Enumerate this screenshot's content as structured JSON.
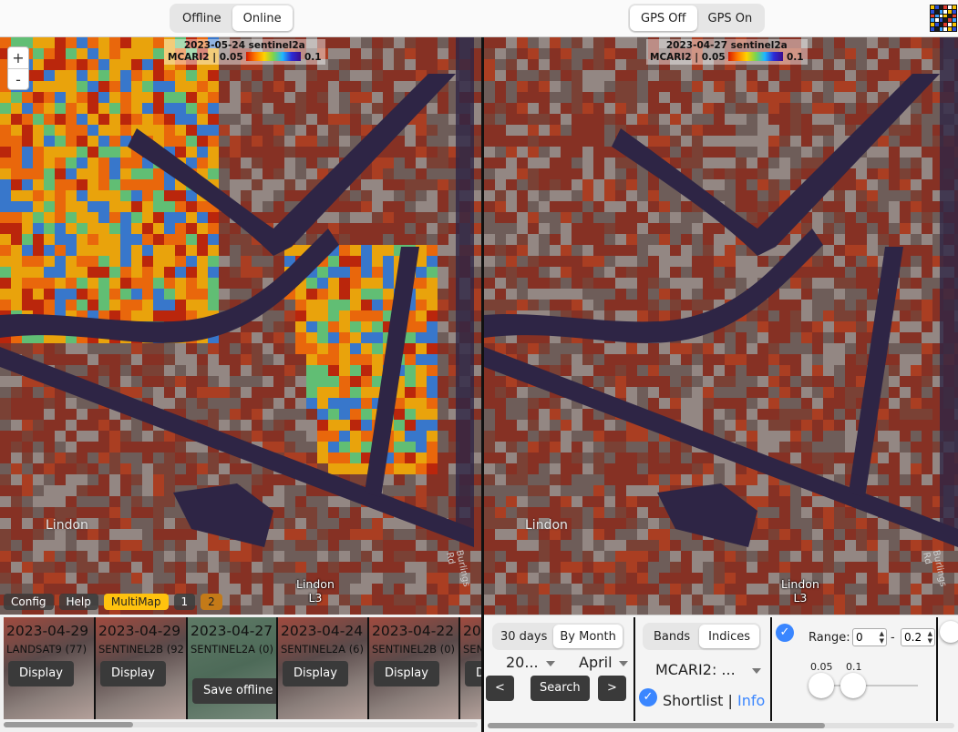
{
  "top_bar": {
    "connection_modes": [
      "Offline",
      "Online"
    ],
    "connection_active": "Online",
    "gps_modes": [
      "GPS Off",
      "GPS On"
    ],
    "gps_active": "GPS Off",
    "logo_icon": "grid-logo-icon"
  },
  "maps": [
    {
      "date_sensor": "2023-05-24 sentinel2a",
      "index": "MCARI2",
      "scale_min": "0.05",
      "scale_max": "0.1",
      "place_label": "Lindon",
      "poi_line1": "Lindon",
      "poi_line2": "L3",
      "road_label": "Burlings Rd"
    },
    {
      "date_sensor": "2023-04-27 sentinel2a",
      "index": "MCARI2",
      "scale_min": "0.05",
      "scale_max": "0.1",
      "place_label": "Lindon",
      "poi_line1": "Lindon",
      "poi_line2": "L3",
      "road_label": "Burlings Rd"
    }
  ],
  "zoom": {
    "in": "+",
    "out": "-"
  },
  "map_buttons": {
    "config": "Config",
    "help": "Help",
    "multimap": "MultiMap",
    "map1": "1",
    "map2": "2"
  },
  "image_strip": [
    {
      "date": "2023-04-29",
      "sensor": "LANDSAT9 (77)",
      "action": "Display"
    },
    {
      "date": "2023-04-29",
      "sensor": "SENTINEL2B (92",
      "action": "Display"
    },
    {
      "date": "2023-04-27",
      "sensor": "SENTINEL2A (0)",
      "action": "Save offline"
    },
    {
      "date": "2023-04-24",
      "sensor": "SENTINEL2A (6)",
      "action": "Display"
    },
    {
      "date": "2023-04-22",
      "sensor": "SENTINEL2B (0)",
      "action": "Display"
    },
    {
      "date": "20",
      "sensor": "SEN",
      "action": "D"
    }
  ],
  "date_panel": {
    "modes": [
      "30 days",
      "By Month"
    ],
    "active_mode": "By Month",
    "year": "20...",
    "month": "April",
    "prev": "<",
    "search": "Search",
    "next": ">"
  },
  "index_panel": {
    "modes": [
      "Bands",
      "Indices"
    ],
    "active_mode": "Indices",
    "selected_index": "MCARI2: ...",
    "shortlist_label": "Shortlist",
    "separator": "|",
    "info_label": "Info"
  },
  "range_panel": {
    "label": "Range:",
    "min_value": "0",
    "dash": "-",
    "max_value": "0.2",
    "slider_low_label": "0.05",
    "slider_high_label": "0.1"
  },
  "colors": {
    "accent_blue": "#3a86ff",
    "multimap_yellow": "#ffc20e",
    "water_dark": "#2e2545",
    "info_link": "#3a86ff"
  }
}
